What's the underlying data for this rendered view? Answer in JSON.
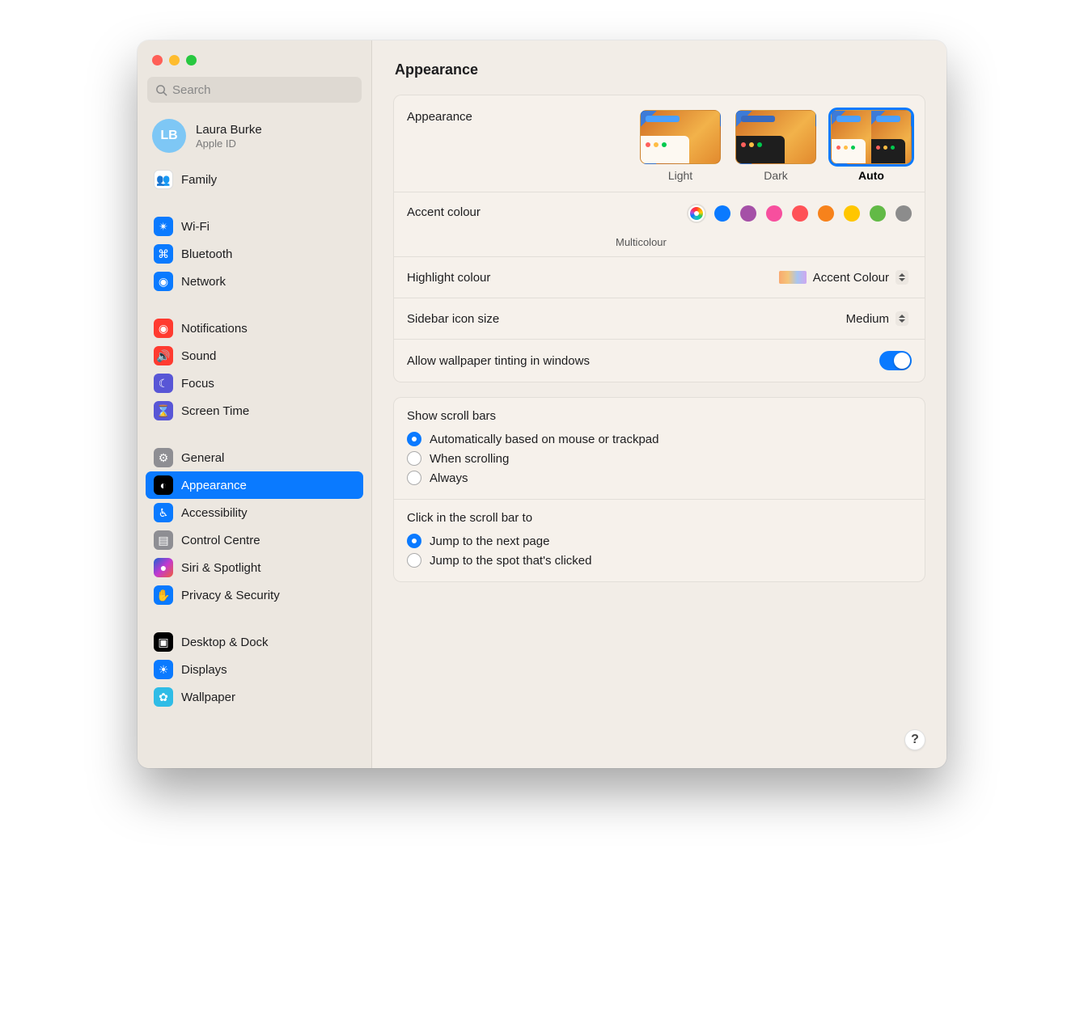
{
  "window": {
    "title": "Appearance"
  },
  "search": {
    "placeholder": "Search"
  },
  "account": {
    "initials": "LB",
    "name": "Laura Burke",
    "sub": "Apple ID"
  },
  "sidebar": {
    "groups": [
      {
        "items": [
          {
            "label": "Family",
            "icon": "family-icon",
            "iconClass": "ic-family",
            "glyph": "👥"
          }
        ]
      },
      {
        "items": [
          {
            "label": "Wi-Fi",
            "icon": "wifi-icon",
            "iconClass": "ic-wifi",
            "glyph": "✴︎"
          },
          {
            "label": "Bluetooth",
            "icon": "bluetooth-icon",
            "iconClass": "ic-bt",
            "glyph": "⌘"
          },
          {
            "label": "Network",
            "icon": "network-icon",
            "iconClass": "ic-net",
            "glyph": "◉"
          }
        ]
      },
      {
        "items": [
          {
            "label": "Notifications",
            "icon": "notifications-icon",
            "iconClass": "ic-notif",
            "glyph": "◉"
          },
          {
            "label": "Sound",
            "icon": "sound-icon",
            "iconClass": "ic-sound",
            "glyph": "🔊"
          },
          {
            "label": "Focus",
            "icon": "focus-icon",
            "iconClass": "ic-focus",
            "glyph": "☾"
          },
          {
            "label": "Screen Time",
            "icon": "screentime-icon",
            "iconClass": "ic-stime",
            "glyph": "⌛"
          }
        ]
      },
      {
        "items": [
          {
            "label": "General",
            "icon": "general-icon",
            "iconClass": "ic-gen",
            "glyph": "⚙"
          },
          {
            "label": "Appearance",
            "icon": "appearance-icon",
            "iconClass": "ic-app",
            "glyph": "◐",
            "selected": true
          },
          {
            "label": "Accessibility",
            "icon": "accessibility-icon",
            "iconClass": "ic-acc",
            "glyph": "♿︎"
          },
          {
            "label": "Control Centre",
            "icon": "controlcentre-icon",
            "iconClass": "ic-cc",
            "glyph": "▤"
          },
          {
            "label": "Siri & Spotlight",
            "icon": "siri-icon",
            "iconClass": "ic-siri",
            "glyph": "●"
          },
          {
            "label": "Privacy & Security",
            "icon": "privacy-icon",
            "iconClass": "ic-priv",
            "glyph": "✋"
          }
        ]
      },
      {
        "items": [
          {
            "label": "Desktop & Dock",
            "icon": "desktop-icon",
            "iconClass": "ic-dock",
            "glyph": "▣"
          },
          {
            "label": "Displays",
            "icon": "displays-icon",
            "iconClass": "ic-disp",
            "glyph": "☀"
          },
          {
            "label": "Wallpaper",
            "icon": "wallpaper-icon",
            "iconClass": "ic-wall",
            "glyph": "✿"
          }
        ]
      }
    ]
  },
  "main": {
    "appearance": {
      "label": "Appearance",
      "options": [
        {
          "label": "Light",
          "kind": "light"
        },
        {
          "label": "Dark",
          "kind": "dark"
        },
        {
          "label": "Auto",
          "kind": "auto",
          "selected": true
        }
      ]
    },
    "accent": {
      "label": "Accent colour",
      "caption": "Multicolour",
      "swatches": [
        {
          "name": "multicolour",
          "color": "multi",
          "selected": true
        },
        {
          "name": "blue",
          "color": "#0a7aff"
        },
        {
          "name": "purple",
          "color": "#a550a7"
        },
        {
          "name": "pink",
          "color": "#f74f9e"
        },
        {
          "name": "red",
          "color": "#ff5257"
        },
        {
          "name": "orange",
          "color": "#f7821b"
        },
        {
          "name": "yellow",
          "color": "#ffc600"
        },
        {
          "name": "green",
          "color": "#62ba46"
        },
        {
          "name": "graphite",
          "color": "#8c8c8c"
        }
      ]
    },
    "highlight": {
      "label": "Highlight colour",
      "value": "Accent Colour"
    },
    "sidebarIcon": {
      "label": "Sidebar icon size",
      "value": "Medium"
    },
    "tinting": {
      "label": "Allow wallpaper tinting in windows",
      "on": true
    },
    "scrollbars": {
      "label": "Show scroll bars",
      "options": [
        {
          "label": "Automatically based on mouse or trackpad",
          "checked": true
        },
        {
          "label": "When scrolling"
        },
        {
          "label": "Always"
        }
      ]
    },
    "clickScroll": {
      "label": "Click in the scroll bar to",
      "options": [
        {
          "label": "Jump to the next page",
          "checked": true
        },
        {
          "label": "Jump to the spot that's clicked"
        }
      ]
    },
    "help": "?"
  }
}
